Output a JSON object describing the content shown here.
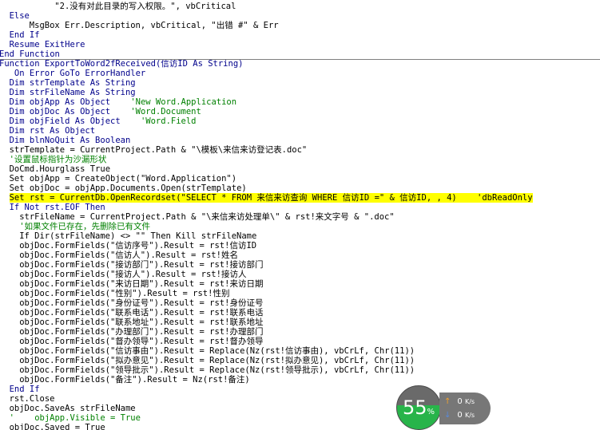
{
  "code_lines": [
    {
      "indent": 11,
      "segments": [
        {
          "t": "\"2.没有对此目录的写入权限。\", vbCritical",
          "c": ""
        }
      ]
    },
    {
      "indent": 2,
      "segments": [
        {
          "t": "Else",
          "c": "kw"
        }
      ]
    },
    {
      "indent": 6,
      "segments": [
        {
          "t": "MsgBox Err.Description, vbCritical, \"出错 #\" & Err",
          "c": ""
        }
      ]
    },
    {
      "indent": 2,
      "segments": [
        {
          "t": "End If",
          "c": "kw"
        }
      ]
    },
    {
      "indent": 2,
      "segments": [
        {
          "t": "Resume ExitHere",
          "c": "kw"
        }
      ]
    },
    {
      "indent": 0,
      "segments": [
        {
          "t": "End Function",
          "c": "kw"
        }
      ]
    },
    {
      "indent": 0,
      "segments": [
        {
          "t": "Function ExportToWord2fReceived(信访ID As String)",
          "c": "kw"
        }
      ]
    },
    {
      "indent": 3,
      "segments": [
        {
          "t": "On Error GoTo ErrorHandler",
          "c": "kw"
        }
      ]
    },
    {
      "indent": 2,
      "segments": [
        {
          "t": "Dim strTemplate As String",
          "c": "kw"
        }
      ]
    },
    {
      "indent": 2,
      "segments": [
        {
          "t": "Dim strFileName As String",
          "c": "kw"
        }
      ]
    },
    {
      "indent": 2,
      "segments": [
        {
          "t": "Dim objApp As Object    ",
          "c": "kw"
        },
        {
          "t": "'New Word.Application",
          "c": "cm"
        }
      ]
    },
    {
      "indent": 2,
      "segments": [
        {
          "t": "Dim objDoc As Object    ",
          "c": "kw"
        },
        {
          "t": "'Word.Document",
          "c": "cm"
        }
      ]
    },
    {
      "indent": 2,
      "segments": [
        {
          "t": "Dim objField As Object    ",
          "c": "kw"
        },
        {
          "t": "'Word.Field",
          "c": "cm"
        }
      ]
    },
    {
      "indent": 2,
      "segments": [
        {
          "t": "Dim rst As Object",
          "c": "kw"
        }
      ]
    },
    {
      "indent": 2,
      "segments": [
        {
          "t": "Dim blnNoQuit As Boolean",
          "c": "kw"
        }
      ]
    },
    {
      "indent": 2,
      "segments": [
        {
          "t": "strTemplate = CurrentProject.Path & \"\\模板\\来信来访登记表.doc\"",
          "c": ""
        }
      ]
    },
    {
      "indent": 2,
      "segments": [
        {
          "t": "'设置鼠标指针为沙漏形状",
          "c": "cm"
        }
      ]
    },
    {
      "indent": 2,
      "segments": [
        {
          "t": "DoCmd.Hourglass True",
          "c": ""
        }
      ]
    },
    {
      "indent": 2,
      "segments": [
        {
          "t": "Set objApp = CreateObject(\"Word.Application\")",
          "c": ""
        }
      ]
    },
    {
      "indent": 2,
      "segments": [
        {
          "t": "Set objDoc = objApp.Documents.Open(strTemplate)",
          "c": ""
        }
      ]
    },
    {
      "indent": 2,
      "highlight": true,
      "segments": [
        {
          "t": "Set rst = CurrentDb.OpenRecordset(\"SELECT * FROM 来信来访查询 WHERE 信访ID =\" & 信访ID, , 4)    'dbReadOnly",
          "c": ""
        }
      ]
    },
    {
      "indent": 2,
      "segments": [
        {
          "t": "If Not rst.EOF Then",
          "c": "kw"
        }
      ]
    },
    {
      "indent": 4,
      "segments": [
        {
          "t": "strFileName = CurrentProject.Path & \"\\来信来访处理单\\\" & rst!来文字号 & \".doc\"",
          "c": ""
        }
      ]
    },
    {
      "indent": 4,
      "segments": [
        {
          "t": "'如果文件已存在，先删除已有文件",
          "c": "cm"
        }
      ]
    },
    {
      "indent": 4,
      "segments": [
        {
          "t": "If Dir(strFileName) <> \"\" Then Kill strFileName",
          "c": ""
        }
      ]
    },
    {
      "indent": 4,
      "segments": [
        {
          "t": "objDoc.FormFields(\"信访序号\").Result = rst!信访ID",
          "c": ""
        }
      ]
    },
    {
      "indent": 4,
      "segments": [
        {
          "t": "objDoc.FormFields(\"信访人\").Result = rst!姓名",
          "c": ""
        }
      ]
    },
    {
      "indent": 4,
      "segments": [
        {
          "t": "objDoc.FormFields(\"接访部门\").Result = rst!接访部门",
          "c": ""
        }
      ]
    },
    {
      "indent": 4,
      "segments": [
        {
          "t": "objDoc.FormFields(\"接访人\").Result = rst!接访人",
          "c": ""
        }
      ]
    },
    {
      "indent": 4,
      "segments": [
        {
          "t": "objDoc.FormFields(\"来访日期\").Result = rst!来访日期",
          "c": ""
        }
      ]
    },
    {
      "indent": 4,
      "segments": [
        {
          "t": "objDoc.FormFields(\"性别\").Result = rst!性别",
          "c": ""
        }
      ]
    },
    {
      "indent": 4,
      "segments": [
        {
          "t": "objDoc.FormFields(\"身份证号\").Result = rst!身份证号",
          "c": ""
        }
      ]
    },
    {
      "indent": 4,
      "segments": [
        {
          "t": "objDoc.FormFields(\"联系电话\").Result = rst!联系电话",
          "c": ""
        }
      ]
    },
    {
      "indent": 4,
      "segments": [
        {
          "t": "objDoc.FormFields(\"联系地址\").Result = rst!联系地址",
          "c": ""
        }
      ]
    },
    {
      "indent": 4,
      "segments": [
        {
          "t": "objDoc.FormFields(\"办理部门\").Result = rst!办理部门",
          "c": ""
        }
      ]
    },
    {
      "indent": 4,
      "segments": [
        {
          "t": "objDoc.FormFields(\"督办领导\").Result = rst!督办领导",
          "c": ""
        }
      ]
    },
    {
      "indent": 4,
      "segments": [
        {
          "t": "objDoc.FormFields(\"信访事由\").Result = Replace(Nz(rst!信访事由), vbCrLf, Chr(11))",
          "c": ""
        }
      ]
    },
    {
      "indent": 4,
      "segments": [
        {
          "t": "objDoc.FormFields(\"拟办意见\").Result = Replace(Nz(rst!拟办意见), vbCrLf, Chr(11))",
          "c": ""
        }
      ]
    },
    {
      "indent": 4,
      "segments": [
        {
          "t": "objDoc.FormFields(\"领导批示\").Result = Replace(Nz(rst!领导批示), vbCrLf, Chr(11))",
          "c": ""
        }
      ]
    },
    {
      "indent": 4,
      "segments": [
        {
          "t": "objDoc.FormFields(\"备注\").Result = Nz(rst!备注)",
          "c": ""
        }
      ]
    },
    {
      "indent": 2,
      "segments": [
        {
          "t": "End If",
          "c": "kw"
        }
      ]
    },
    {
      "indent": 2,
      "segments": [
        {
          "t": "rst.Close",
          "c": ""
        }
      ]
    },
    {
      "indent": 2,
      "segments": [
        {
          "t": "objDoc.SaveAs strFileName",
          "c": ""
        }
      ]
    },
    {
      "indent": 2,
      "segments": [
        {
          "t": "'    objApp.Visible = True",
          "c": "cm"
        }
      ]
    },
    {
      "indent": 2,
      "segments": [
        {
          "t": "objDoc.Saved = True",
          "c": ""
        }
      ]
    }
  ],
  "net_widget": {
    "cpu_percent": 55,
    "percent_label": "55",
    "percent_unit": "%",
    "upload_value": "0",
    "upload_unit": "K/s",
    "download_value": "0",
    "download_unit": "K/s",
    "up_icon": "arrow-up-icon",
    "down_icon": "arrow-down-icon",
    "colors": {
      "fill": "#28b44a",
      "panel": "#777777",
      "up": "#f0a030",
      "down": "#5a8ad8"
    }
  }
}
